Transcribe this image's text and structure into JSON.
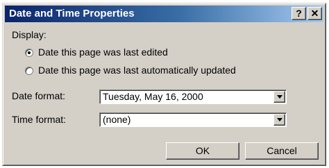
{
  "window": {
    "title": "Date and Time Properties",
    "help_glyph": "?",
    "close_glyph": "✕"
  },
  "display": {
    "label": "Display:",
    "options": [
      {
        "label": "Date this page was last edited",
        "selected": true
      },
      {
        "label": "Date this page was last automatically updated",
        "selected": false
      }
    ]
  },
  "date_format": {
    "label": "Date format:",
    "value": "Tuesday, May 16, 2000"
  },
  "time_format": {
    "label": "Time format:",
    "value": "(none)"
  },
  "buttons": {
    "ok": "OK",
    "cancel": "Cancel"
  },
  "icons": {
    "dropdown": "chevron-down-icon",
    "help": "help-icon",
    "close": "close-icon"
  }
}
